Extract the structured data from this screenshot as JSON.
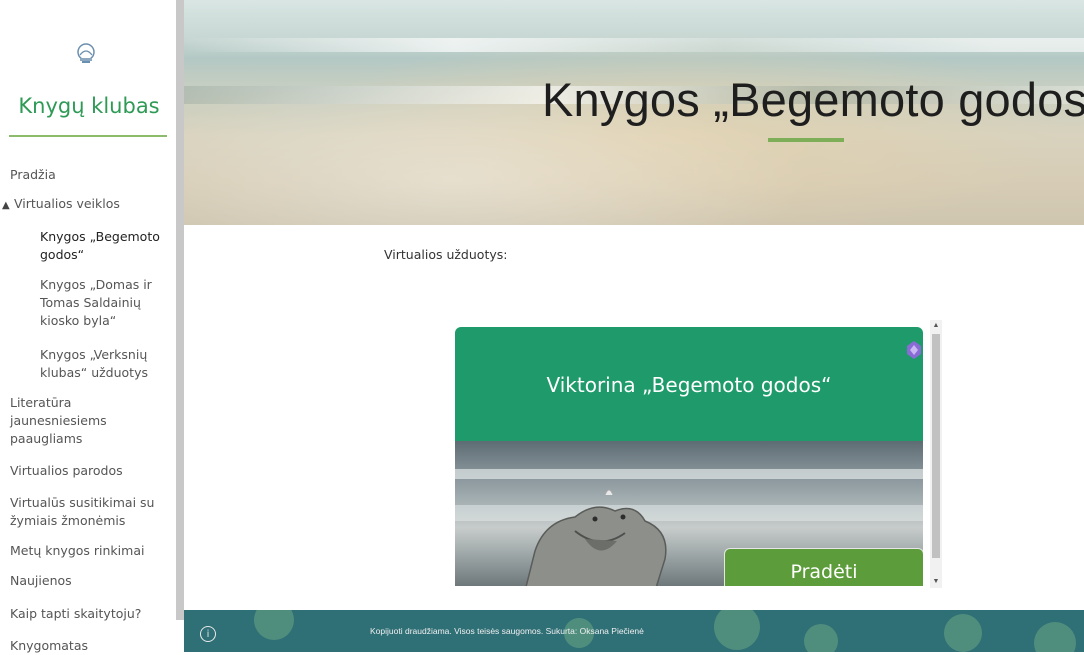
{
  "sidebar": {
    "site_title": "Knygų klubas",
    "nav": [
      {
        "label": "Pradžia"
      },
      {
        "label": "Virtualios veiklos",
        "expanded": true
      },
      {
        "label": "Knygos „Begemoto godos“",
        "active": true
      },
      {
        "label": "Knygos „Domas ir Tomas Saldainių kiosko byla“"
      },
      {
        "label": "Knygos „Verksnių klubas“ užduotys"
      },
      {
        "label": "Literatūra jaunesniesiems paaugliams"
      },
      {
        "label": "Virtualios parodos"
      },
      {
        "label": "Virtualūs susitikimai su žymiais žmonėmis"
      },
      {
        "label": "Metų knygos rinkimai"
      },
      {
        "label": "Naujienos"
      },
      {
        "label": "Kaip tapti skaitytoju?"
      },
      {
        "label": "Knygomatas"
      }
    ]
  },
  "hero": {
    "title": "Knygos „Begemoto godos“"
  },
  "content": {
    "label": "Virtualios užduotys:"
  },
  "quiz": {
    "title": "Viktorina „Begemoto godos“",
    "start_label": "Pradėti"
  },
  "footer": {
    "text": "Kopijuoti draudžiama. Visos teisės saugomos. Sukurta: Oksana Piečienė",
    "info_glyph": "i"
  },
  "colors": {
    "brand_green": "#2e9a55",
    "quiz_green": "#1f9b6b",
    "button_green": "#5c9c3a",
    "footer_teal": "#2f6f76"
  }
}
